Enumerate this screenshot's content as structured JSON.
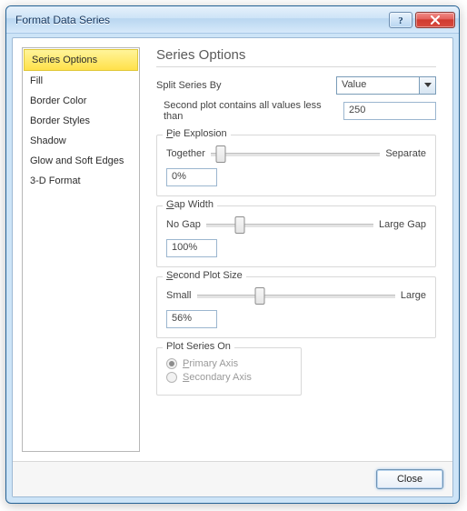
{
  "window": {
    "title": "Format Data Series"
  },
  "sidebar": {
    "items": [
      {
        "label": "Series Options",
        "selected": true
      },
      {
        "label": "Fill"
      },
      {
        "label": "Border Color"
      },
      {
        "label": "Border Styles"
      },
      {
        "label": "Shadow"
      },
      {
        "label": "Glow and Soft Edges"
      },
      {
        "label": "3-D Format"
      }
    ]
  },
  "panel": {
    "heading": "Series Options",
    "split_by_label": "Split Series By",
    "split_by_value": "Value",
    "second_plot_label": "Second plot contains all values less than",
    "second_plot_value": "250",
    "pie_explosion": {
      "legend": "Pie Explosion",
      "left": "Together",
      "right": "Separate",
      "value": "0%",
      "pct": 0
    },
    "gap_width": {
      "legend": "Gap Width",
      "left": "No Gap",
      "right": "Large Gap",
      "value": "100%",
      "pct": 20
    },
    "second_plot_size": {
      "legend": "Second Plot Size",
      "left": "Small",
      "right": "Large",
      "value": "56%",
      "pct": 32
    },
    "plot_series_on": {
      "legend": "Plot Series On",
      "primary": "Primary Axis",
      "secondary": "Secondary Axis",
      "selected": "primary",
      "disabled": true
    }
  },
  "footer": {
    "close": "Close"
  }
}
